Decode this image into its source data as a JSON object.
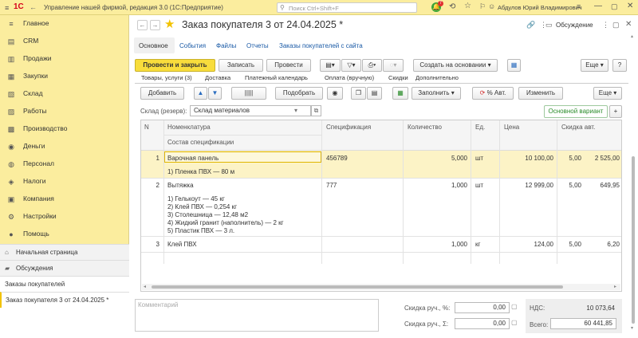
{
  "app": {
    "logo_text": "1С",
    "title": "Управление нашей фирмой, редакция 3.0  (1С:Предприятие)",
    "search_placeholder": "Поиск Ctrl+Shift+F",
    "notification_count": "7",
    "user": "Абдулов Юрий Владимирович"
  },
  "sidebar": {
    "items": [
      {
        "label": "Главное",
        "icon": "≡"
      },
      {
        "label": "CRM",
        "icon": "▤"
      },
      {
        "label": "Продажи",
        "icon": "▥"
      },
      {
        "label": "Закупки",
        "icon": "▦"
      },
      {
        "label": "Склад",
        "icon": "▧"
      },
      {
        "label": "Работы",
        "icon": "▨"
      },
      {
        "label": "Производство",
        "icon": "▩"
      },
      {
        "label": "Деньги",
        "icon": "◉"
      },
      {
        "label": "Персонал",
        "icon": "◍"
      },
      {
        "label": "Налоги",
        "icon": "◈"
      },
      {
        "label": "Компания",
        "icon": "▣"
      },
      {
        "label": "Настройки",
        "icon": "⚙"
      },
      {
        "label": "Помощь",
        "icon": "●"
      }
    ],
    "home": "Начальная страница",
    "discussions": "Обсуждения",
    "open_list": "Заказы покупателей",
    "open_doc": "Заказ покупателя 3 от 24.04.2025 *"
  },
  "doc": {
    "title": "Заказ покупателя 3 от 24.04.2025 *",
    "discussion_btn": "Обсуждение",
    "nav_tabs": [
      "Основное",
      "События",
      "Файлы",
      "Отчеты",
      "Заказы покупателей с сайта"
    ],
    "toolbar": {
      "post_close": "Провести и закрыть",
      "save": "Записать",
      "post": "Провести",
      "create_based": "Создать на основании",
      "more": "Еще",
      "help": "?"
    },
    "inner_tabs": [
      "Товары, услуги (3)",
      "Доставка",
      "Платежный календарь",
      "Оплата (вручную)",
      "Скидки",
      "Дополнительно"
    ],
    "table_toolbar": {
      "add": "Добавить",
      "pick": "Подобрать",
      "fill": "Заполнить",
      "auto_pct": "% Авт.",
      "change": "Изменить",
      "more": "Еще"
    },
    "warehouse_label": "Склад (резерв):",
    "warehouse_value": "Склад материалов",
    "main_variant": "Основной вариант",
    "plus": "+",
    "columns": {
      "n": "N",
      "nomenclature": "Номенклатура",
      "spec_composition": "Состав спецификации",
      "spec": "Спецификация",
      "qty": "Количество",
      "unit": "Ед.",
      "price": "Цена",
      "discount": "Скидка авт."
    },
    "rows": [
      {
        "n": "1",
        "name": "Варочная панель",
        "composition": [
          "1) Пленка ПВХ  — 80 м"
        ],
        "spec": "456789",
        "qty": "5,000",
        "unit": "шт",
        "price": "10 100,00",
        "pct": "5,00",
        "discount": "2 525,00"
      },
      {
        "n": "2",
        "name": "Вытяжка",
        "composition": [
          "1) Гелькоут — 45 кг",
          "2) Клей ПВХ — 0,254 кг",
          "3) Столешница — 12,48 м2",
          "4) Жидкий гранит (наполнитель) — 2 кг",
          "5) Пластик ПВХ — 3 л."
        ],
        "spec": "777",
        "qty": "1,000",
        "unit": "шт",
        "price": "12 999,00",
        "pct": "5,00",
        "discount": "649,95"
      },
      {
        "n": "3",
        "name": "Клей ПВХ",
        "composition": [],
        "spec": "",
        "qty": "1,000",
        "unit": "кг",
        "price": "124,00",
        "pct": "5,00",
        "discount": "6,20"
      }
    ],
    "comment_placeholder": "Комментарий",
    "manual_disc_pct_label": "Скидка руч., %:",
    "manual_disc_pct": "0,00",
    "manual_disc_sum_label": "Скидка руч., Σ:",
    "manual_disc_sum": "0,00",
    "vat_label": "НДС:",
    "vat": "10 073,64",
    "total_label": "Всего:",
    "total": "60 441,85"
  }
}
